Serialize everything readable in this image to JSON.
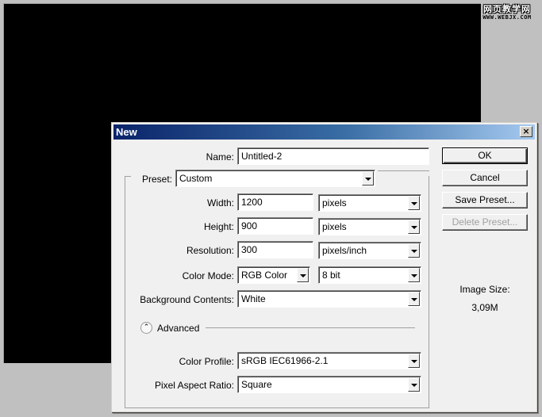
{
  "watermark": {
    "text_cn": "网页教学网",
    "url": "WWW.WEBJX.COM"
  },
  "dialog": {
    "title": "New",
    "close_glyph": "×",
    "name": {
      "label": "Name:",
      "value": "Untitled-2"
    },
    "preset": {
      "label": "Preset:",
      "value": "Custom"
    },
    "width": {
      "label": "Width:",
      "value": "1200",
      "unit": "pixels"
    },
    "height": {
      "label": "Height:",
      "value": "900",
      "unit": "pixels"
    },
    "resolution": {
      "label": "Resolution:",
      "value": "300",
      "unit": "pixels/inch"
    },
    "color_mode": {
      "label": "Color Mode:",
      "value": "RGB Color",
      "depth": "8 bit"
    },
    "background": {
      "label": "Background Contents:",
      "value": "White"
    },
    "advanced": {
      "label": "Advanced",
      "toggle_glyph": "⌃"
    },
    "color_profile": {
      "label": "Color Profile:",
      "value": "sRGB IEC61966-2.1"
    },
    "pixel_aspect": {
      "label": "Pixel Aspect Ratio:",
      "value": "Square"
    },
    "buttons": {
      "ok": "OK",
      "cancel": "Cancel",
      "save_preset": "Save Preset...",
      "delete_preset": "Delete Preset..."
    },
    "image_size": {
      "label": "Image Size:",
      "value": "3,09M"
    }
  }
}
